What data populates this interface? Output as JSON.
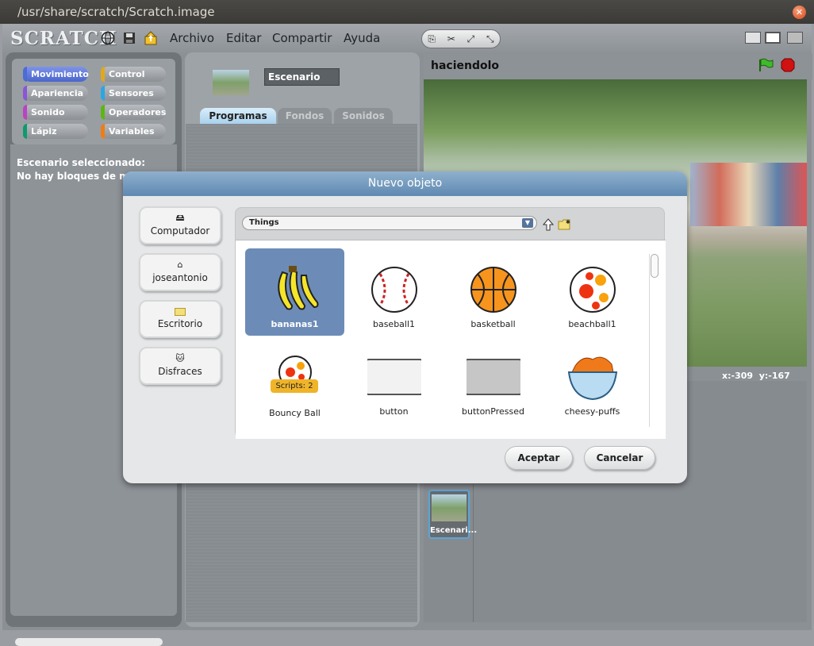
{
  "window": {
    "title": "/usr/share/scratch/Scratch.image"
  },
  "menubar": {
    "logo": "SCRATCH",
    "menus": [
      "Archivo",
      "Editar",
      "Compartir",
      "Ayuda"
    ]
  },
  "palette": {
    "categories": [
      {
        "label": "Movimiento",
        "color": "#4a6cd4"
      },
      {
        "label": "Control",
        "color": "#e1a91a"
      },
      {
        "label": "Apariencia",
        "color": "#8a55d7"
      },
      {
        "label": "Sensores",
        "color": "#2ca5e2"
      },
      {
        "label": "Sonido",
        "color": "#bb42c3"
      },
      {
        "label": "Operadores",
        "color": "#5cb712"
      },
      {
        "label": "Lápiz",
        "color": "#0e9a6c"
      },
      {
        "label": "Variables",
        "color": "#ee7d16"
      }
    ],
    "message_line1": "Escenario seleccionado:",
    "message_line2": "No hay bloques de m"
  },
  "sprite_info": {
    "name": "Escenario",
    "tabs": [
      "Programas",
      "Fondos",
      "Sonidos"
    ]
  },
  "stage": {
    "title": "haciendolo",
    "x_label": "x:",
    "x_value": "-309",
    "y_label": "y:",
    "y_value": "-167",
    "thumb_label": "Escenari..."
  },
  "dialog": {
    "title": "Nuevo objeto",
    "places": [
      "Computador",
      "joseantonio",
      "Escritorio",
      "Disfraces"
    ],
    "path": "Things",
    "items": [
      "bananas1",
      "baseball1",
      "basketball",
      "beachball1",
      "Bouncy Ball",
      "button",
      "buttonPressed",
      "cheesy-puffs"
    ],
    "scripts_badge": "Scripts: 2",
    "ok": "Aceptar",
    "cancel": "Cancelar"
  }
}
